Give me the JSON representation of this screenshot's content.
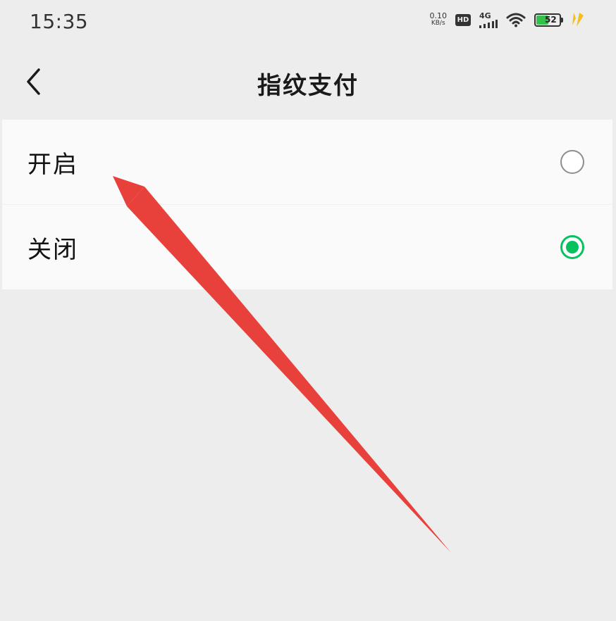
{
  "status_bar": {
    "time": "15:35",
    "net_speed_value": "0.10",
    "net_speed_unit": "KB/s",
    "hd_label": "HD",
    "network_label": "4G",
    "battery_level": "52",
    "battery_fraction": 0.52,
    "battery_color": "#35c04a",
    "icons": [
      "hd-icon",
      "signal-icon",
      "wifi-icon",
      "battery-icon",
      "charging-icon"
    ]
  },
  "title_bar": {
    "back_icon": "chevron-left-icon",
    "title": "指纹支付"
  },
  "options": [
    {
      "label": "开启",
      "selected": false
    },
    {
      "label": "关闭",
      "selected": true
    }
  ],
  "colors": {
    "background": "#ededed",
    "list_background": "#fafafa",
    "accent_green": "#07c160",
    "annotation_red": "#e8403b"
  }
}
